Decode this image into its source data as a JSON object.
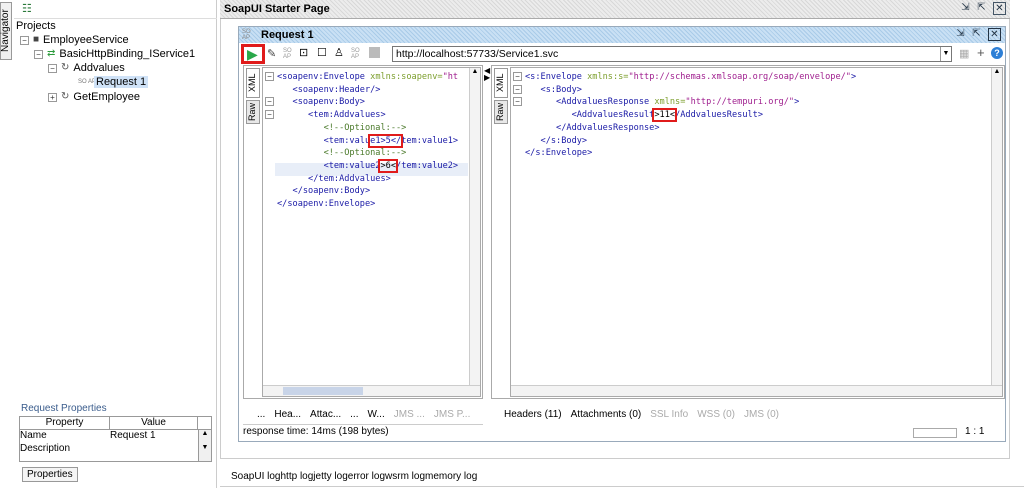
{
  "navigator_tab": "Navigator",
  "tree": {
    "root": "Projects",
    "project": "EmployeeService",
    "binding": "BasicHttpBinding_IService1",
    "operation1": "Addvalues",
    "request": "Request 1",
    "operation2": "GetEmployee",
    "soap_badge": "SO AP"
  },
  "request_properties": {
    "title": "Request Properties",
    "headers": [
      "Property",
      "Value"
    ],
    "rows": [
      [
        "Name",
        "Request 1"
      ],
      [
        "Description",
        ""
      ]
    ],
    "button": "Properties"
  },
  "starter_page": {
    "title": "SoapUI Starter Page"
  },
  "request_window": {
    "title": "Request 1",
    "endpoint": "http://localhost:57733/Service1.svc",
    "left_tabs": {
      "xml": "XML",
      "raw": "Raw"
    },
    "right_tabs": {
      "xml": "XML",
      "raw": "Raw"
    },
    "request_bottom_tabs": [
      "...",
      "Hea...",
      "Attac...",
      "...",
      "W...",
      "JMS ...",
      "JMS P..."
    ],
    "response_bottom_tabs": [
      "Headers (11)",
      "Attachments (0)",
      "SSL Info",
      "WSS (0)",
      "JMS (0)"
    ],
    "status": "response time: 14ms (198 bytes)",
    "cursor_pos": "1 : 1"
  },
  "request_xml": [
    [
      {
        "t": "<soapenv:Envelope ",
        "c": "t"
      },
      {
        "t": "xmlns:soapenv=",
        "c": "a"
      },
      {
        "t": "\"ht",
        "c": "s"
      }
    ],
    [
      {
        "t": "   <soapenv:Header/>",
        "c": "t"
      }
    ],
    [
      {
        "t": "   <soapenv:Body>",
        "c": "t"
      }
    ],
    [
      {
        "t": "      <tem:Addvalues>",
        "c": "t"
      }
    ],
    [
      {
        "t": "         <!--Optional:-->",
        "c": "c"
      }
    ],
    [
      {
        "t": "         <tem:valu",
        "c": "t"
      },
      {
        "t": "e1>5</",
        "c": "t",
        "h": 1
      },
      {
        "t": "tem:value1>",
        "c": "t"
      }
    ],
    [
      {
        "t": "         <!--Optional:-->",
        "c": "c"
      }
    ],
    [
      {
        "t": "         <tem:value2",
        "c": "t"
      },
      {
        "t": ">6<",
        "c": "v",
        "h": 1
      },
      {
        "t": "/tem:value2>",
        "c": "t"
      }
    ],
    [
      {
        "t": "      </tem:Addvalues>",
        "c": "t"
      }
    ],
    [
      {
        "t": "   </soapenv:Body>",
        "c": "t"
      }
    ],
    [
      {
        "t": "</soapenv:Envelope>",
        "c": "t"
      }
    ]
  ],
  "response_xml": [
    [
      {
        "t": "<s:Envelope ",
        "c": "t"
      },
      {
        "t": "xmlns:s=",
        "c": "a"
      },
      {
        "t": "\"http://schemas.xmlsoap.org/soap/envelope/\"",
        "c": "s"
      },
      {
        "t": ">",
        "c": "t"
      }
    ],
    [
      {
        "t": "   <s:Body>",
        "c": "t"
      }
    ],
    [
      {
        "t": "      <AddvaluesResponse ",
        "c": "t"
      },
      {
        "t": "xmlns=",
        "c": "a"
      },
      {
        "t": "\"http://tempuri.org/\"",
        "c": "s"
      },
      {
        "t": ">",
        "c": "t"
      }
    ],
    [
      {
        "t": "         <AddvaluesResult",
        "c": "t"
      },
      {
        "t": ">11<",
        "c": "v",
        "h": 1
      },
      {
        "t": "/AddvaluesResult>",
        "c": "t"
      }
    ],
    [
      {
        "t": "      </AddvaluesResponse>",
        "c": "t"
      }
    ],
    [
      {
        "t": "   </s:Body>",
        "c": "t"
      }
    ],
    [
      {
        "t": "</s:Envelope>",
        "c": "t"
      }
    ]
  ],
  "log_tabs": [
    "SoapUI log",
    "http log",
    "jetty log",
    "error log",
    "wsrm log",
    "memory log"
  ]
}
